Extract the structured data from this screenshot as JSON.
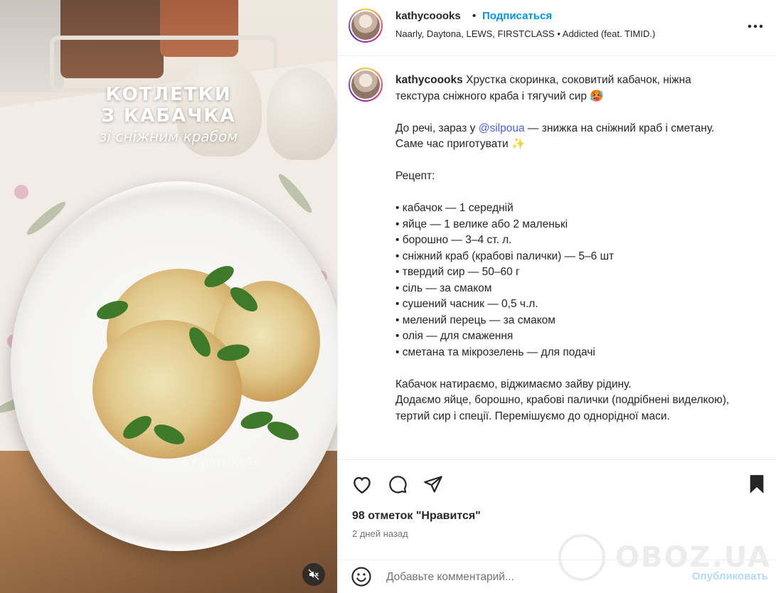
{
  "media": {
    "title_line1": "КОТЛЕТКИ",
    "title_line2": "З КАБАЧКА",
    "subtitle": "зі сніжним крабом",
    "plate_watermark": "@kathycoooks",
    "mute_icon": "speaker-muted-icon"
  },
  "header": {
    "username": "kathycoooks",
    "separator": "•",
    "follow_label": "Подписаться",
    "music": "Naarly, Daytona, LEWS, FIRSTCLASS • Addicted (feat. TIMID.)",
    "more_icon": "more-horizontal-icon"
  },
  "caption": {
    "username": "kathycoooks",
    "p1": " Хрустка скоринка, соковитий кабачок, ніжна текстура сніжного краба і тягучий сир 🥵",
    "p2_before": "До речі, зараз у ",
    "mention": "@silpoua",
    "p2_after": " — знижка на сніжний краб і сметану. Саме час приготувати ✨",
    "recipe_title": "Рецепт:",
    "ingredients": [
      "• кабачок — 1 середній",
      "• яйце — 1 велике або 2 маленькі",
      "• борошно — 3–4 ст. л.",
      "• сніжний краб (крабові палички) — 5–6 шт",
      "• твердий сир — 50–60 г",
      "• сіль — за смаком",
      "• сушений часник — 0,5 ч.л.",
      "• мелений перець — за смаком",
      "• олія — для смаження",
      "• сметана та мікрозелень — для подачі"
    ],
    "steps": "Кабачок натираємо, віджимаємо зайву рідину.\nДодаємо яйце, борошно, крабові палички (подрібнені виделкою), тертий сир і спеції. Перемішуємо до однорідної маси."
  },
  "actions": {
    "like_icon": "heart-icon",
    "comment_icon": "comment-bubble-icon",
    "share_icon": "paper-plane-icon",
    "save_icon": "bookmark-icon",
    "likes": "98 отметок \"Нравится\"",
    "time": "2 дней назад"
  },
  "comment": {
    "emoji_icon": "smiley-icon",
    "placeholder": "Добавьте комментарий...",
    "publish_label": "Опубликовать"
  },
  "watermark": {
    "text": "OBOZ.UA"
  },
  "colors": {
    "accent": "#0095f6",
    "mention": "#4a5df9",
    "publish_disabled": "#b3dbff",
    "text": "#262626",
    "muted": "#737373"
  }
}
